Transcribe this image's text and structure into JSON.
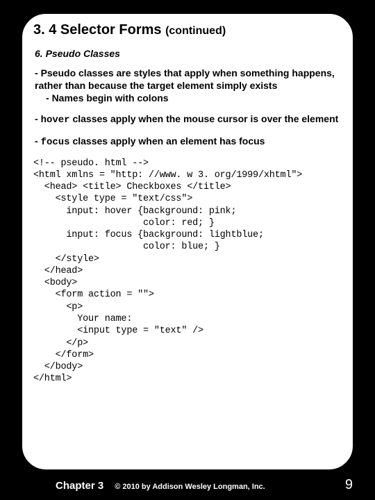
{
  "title": {
    "main": "3. 4 Selector Forms ",
    "cont": "(continued)"
  },
  "subheading": "6. Pseudo Classes",
  "bullets": {
    "b1": {
      "dash": "- ",
      "text": "Pseudo classes are styles that apply when something happens, rather than because the target element simply exists",
      "sub_dash": "- ",
      "sub_text": "Names begin with colons"
    },
    "b2": {
      "dash": "- ",
      "mono": "hover",
      "text": " classes apply when the mouse cursor is over the element"
    },
    "b3": {
      "dash": "- ",
      "mono": "focus",
      "text": " classes apply when an element has focus"
    }
  },
  "code": "<!-- pseudo. html -->\n<html xmlns = \"http: //www. w 3. org/1999/xhtml\">\n  <head> <title> Checkboxes </title>\n    <style type = \"text/css\">\n      input: hover {background: pink;\n                    color: red; }\n      input: focus {background: lightblue;\n                    color: blue; }\n    </style>\n  </head>\n  <body>\n    <form action = \"\">\n      <p>\n        Your name:\n        <input type = \"text\" />\n      </p>\n    </form>\n  </body>\n</html>",
  "footer": {
    "chapter": "Chapter 3",
    "copy": "© 2010 by Addison Wesley Longman, Inc.",
    "page": "9"
  }
}
